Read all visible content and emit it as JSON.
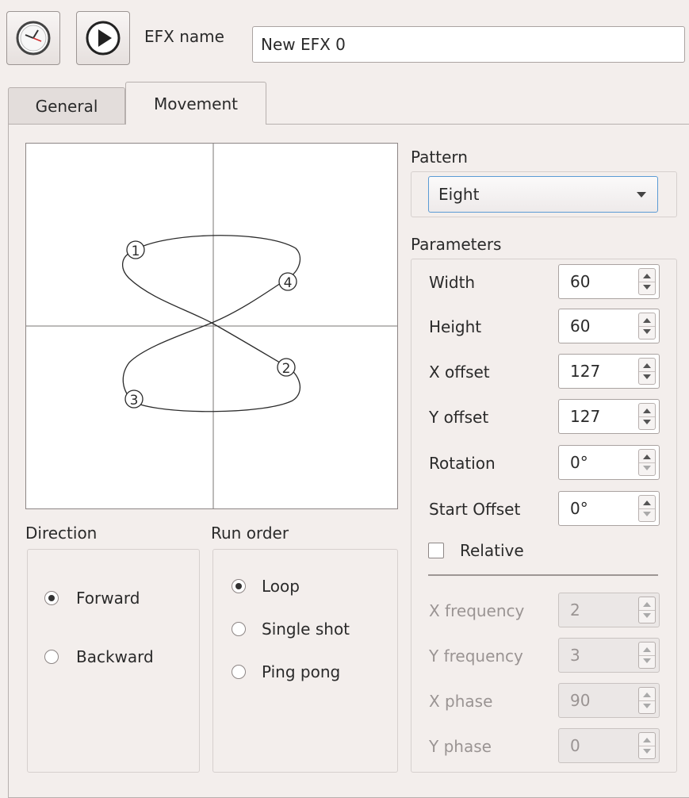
{
  "toolbar": {
    "speed_icon": "clock-icon",
    "test_icon": "play-icon",
    "name_label": "EFX name",
    "name_value": "New EFX 0"
  },
  "tabs": [
    {
      "label": "General",
      "active": false
    },
    {
      "label": "Movement",
      "active": true
    }
  ],
  "preview": {
    "points": [
      "1",
      "2",
      "3",
      "4"
    ]
  },
  "pattern": {
    "label": "Pattern",
    "selected": "Eight"
  },
  "parameters": {
    "label": "Parameters",
    "width": {
      "label": "Width",
      "value": "60"
    },
    "height": {
      "label": "Height",
      "value": "60"
    },
    "x_offset": {
      "label": "X offset",
      "value": "127"
    },
    "y_offset": {
      "label": "Y offset",
      "value": "127"
    },
    "rotation": {
      "label": "Rotation",
      "value": "0°"
    },
    "start_offset": {
      "label": "Start Offset",
      "value": "0°"
    },
    "relative": {
      "label": "Relative",
      "checked": false
    },
    "x_frequency": {
      "label": "X frequency",
      "value": "2"
    },
    "y_frequency": {
      "label": "Y frequency",
      "value": "3"
    },
    "x_phase": {
      "label": "X phase",
      "value": "90"
    },
    "y_phase": {
      "label": "Y phase",
      "value": "0"
    }
  },
  "direction": {
    "label": "Direction",
    "options": [
      {
        "label": "Forward",
        "checked": true
      },
      {
        "label": "Backward",
        "checked": false
      }
    ]
  },
  "run_order": {
    "label": "Run order",
    "options": [
      {
        "label": "Loop",
        "checked": true
      },
      {
        "label": "Single shot",
        "checked": false
      },
      {
        "label": "Ping pong",
        "checked": false
      }
    ]
  }
}
